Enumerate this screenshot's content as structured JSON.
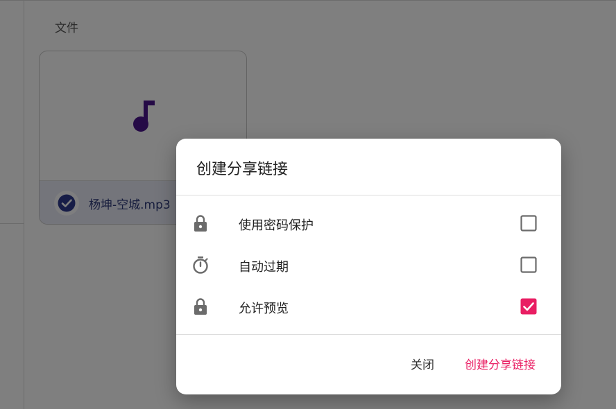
{
  "page": {
    "section_title": "文件"
  },
  "file_card": {
    "file_name": "杨坤-空城.mp3",
    "icon": "music-note-icon",
    "selected": true,
    "icon_color": "#4a148c",
    "selection_color": "#2f3a8f"
  },
  "dialog": {
    "title": "创建分享链接",
    "options": [
      {
        "icon": "lock-icon",
        "label": "使用密码保护",
        "checked": false
      },
      {
        "icon": "timer-icon",
        "label": "自动过期",
        "checked": false
      },
      {
        "icon": "lock-icon",
        "label": "允许预览",
        "checked": true
      }
    ],
    "close_label": "关闭",
    "create_label": "创建分享链接",
    "accent_color": "#e91e63"
  }
}
